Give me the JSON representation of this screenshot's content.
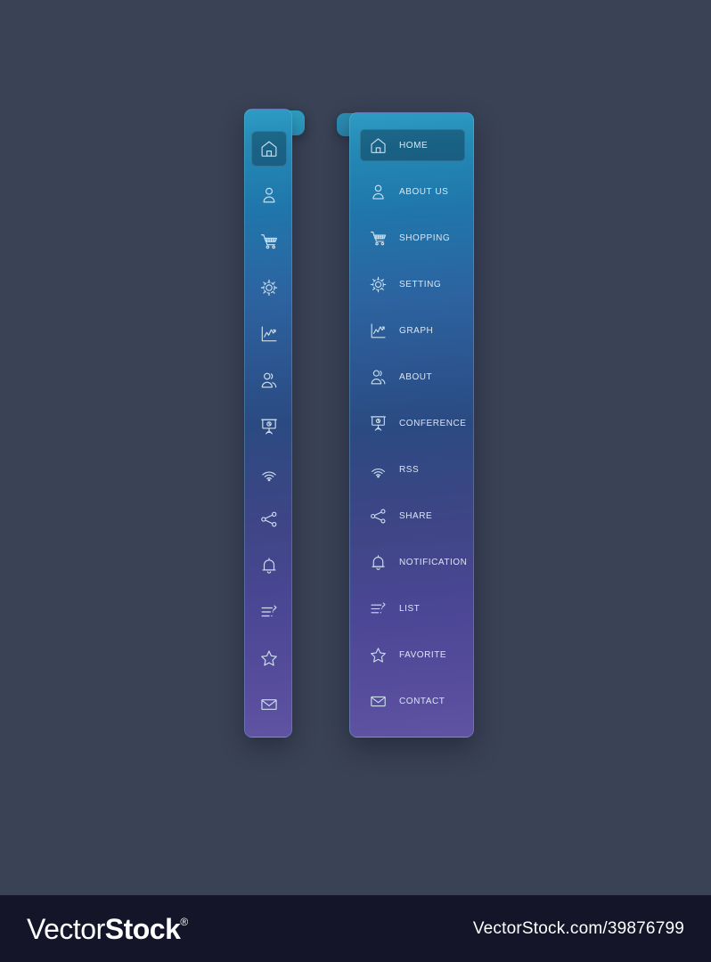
{
  "theme": {
    "page_background": "#3a4256",
    "panel_gradient_top": "#2e9cc4",
    "panel_gradient_mid": "#2b4a82",
    "panel_gradient_bottom": "#5f53a2",
    "accent_cyan": "#35e6ef",
    "icon_stroke": "#cfe0ee",
    "label_color": "#dce6f0",
    "footer_background": "#141529"
  },
  "collapsed_sidebar": {
    "toggle": {
      "name": "expand-sidebar-toggle",
      "glyph": "»"
    },
    "items": [
      {
        "icon": "home-icon",
        "active": true
      },
      {
        "icon": "user-icon",
        "active": false
      },
      {
        "icon": "shopping-cart-icon",
        "active": false
      },
      {
        "icon": "gear-icon",
        "active": false
      },
      {
        "icon": "graph-icon",
        "active": false
      },
      {
        "icon": "users-icon",
        "active": false
      },
      {
        "icon": "conference-icon",
        "active": false
      },
      {
        "icon": "rss-icon",
        "active": false
      },
      {
        "icon": "share-icon",
        "active": false
      },
      {
        "icon": "bell-icon",
        "active": false
      },
      {
        "icon": "list-icon",
        "active": false
      },
      {
        "icon": "star-icon",
        "active": false
      },
      {
        "icon": "mail-icon",
        "active": false
      }
    ]
  },
  "expanded_sidebar": {
    "toggle": {
      "name": "collapse-sidebar-toggle",
      "glyph": "«"
    },
    "items": [
      {
        "label": "HOME",
        "icon": "home-icon",
        "active": true
      },
      {
        "label": "ABOUT US",
        "icon": "user-icon",
        "active": false
      },
      {
        "label": "SHOPPING",
        "icon": "shopping-cart-icon",
        "active": false
      },
      {
        "label": "SETTING",
        "icon": "gear-icon",
        "active": false
      },
      {
        "label": "GRAPH",
        "icon": "graph-icon",
        "active": false
      },
      {
        "label": "ABOUT",
        "icon": "users-icon",
        "active": false
      },
      {
        "label": "CONFERENCE",
        "icon": "conference-icon",
        "active": false
      },
      {
        "label": "RSS",
        "icon": "rss-icon",
        "active": false
      },
      {
        "label": "SHARE",
        "icon": "share-icon",
        "active": false
      },
      {
        "label": "NOTIFICATION",
        "icon": "bell-icon",
        "active": false
      },
      {
        "label": "LIST",
        "icon": "list-icon",
        "active": false
      },
      {
        "label": "FAVORITE",
        "icon": "star-icon",
        "active": false
      },
      {
        "label": "CONTACT",
        "icon": "mail-icon",
        "active": false
      }
    ]
  },
  "footer": {
    "brand_part1": "Vector",
    "brand_part2": "Stock",
    "brand_registered": "®",
    "url": "VectorStock.com/39876799"
  }
}
